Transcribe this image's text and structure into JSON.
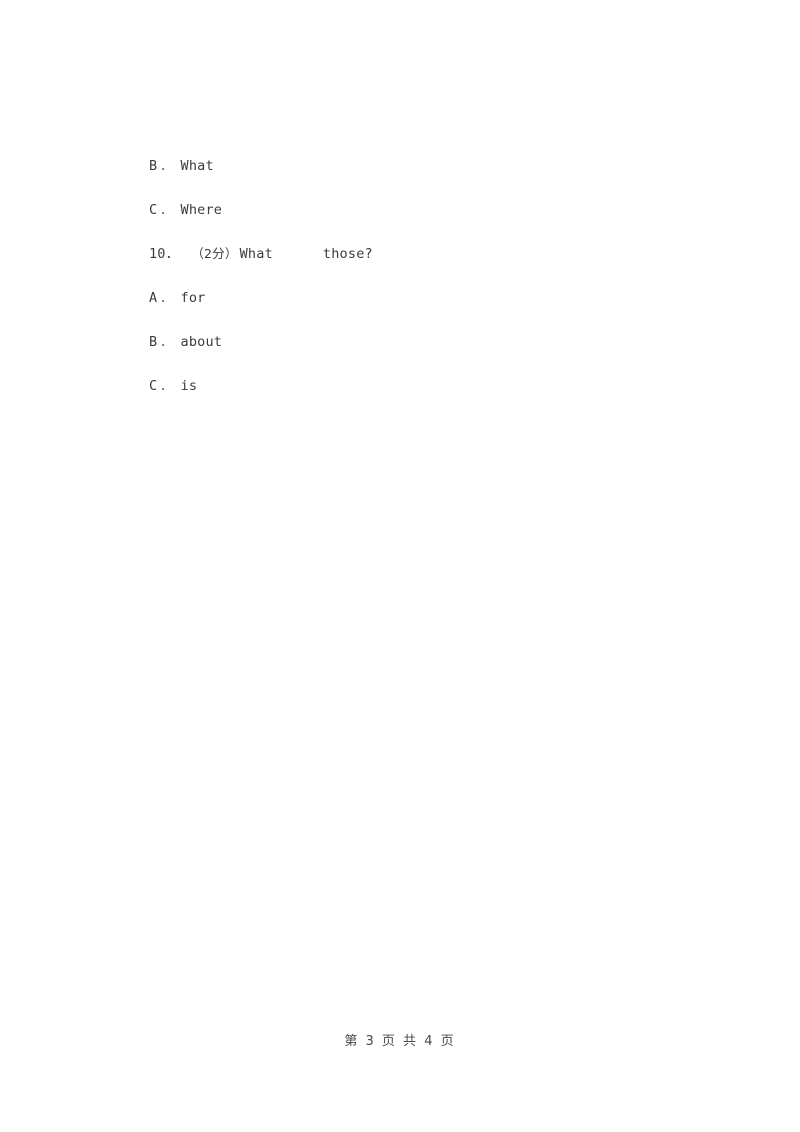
{
  "document": {
    "background_color": "#ffffff",
    "text_color": "#3c3c3c"
  },
  "body_lines": [
    {
      "kind": "option",
      "letter": "B",
      "separator": "．",
      "text": "What"
    },
    {
      "kind": "option",
      "letter": "C",
      "separator": "．",
      "text": "Where"
    },
    {
      "kind": "question",
      "number": "10．",
      "score": "（2分）",
      "stem_before_blank": "What",
      "blank": "",
      "stem_after_blank": "those?"
    },
    {
      "kind": "option",
      "letter": "A",
      "separator": "．",
      "text": "for"
    },
    {
      "kind": "option",
      "letter": "B",
      "separator": "．",
      "text": "about"
    },
    {
      "kind": "option",
      "letter": "C",
      "separator": "．",
      "text": "is"
    }
  ],
  "footer": {
    "text": "第 3 页 共 4 页",
    "current_page": "3",
    "total_pages": "4"
  }
}
